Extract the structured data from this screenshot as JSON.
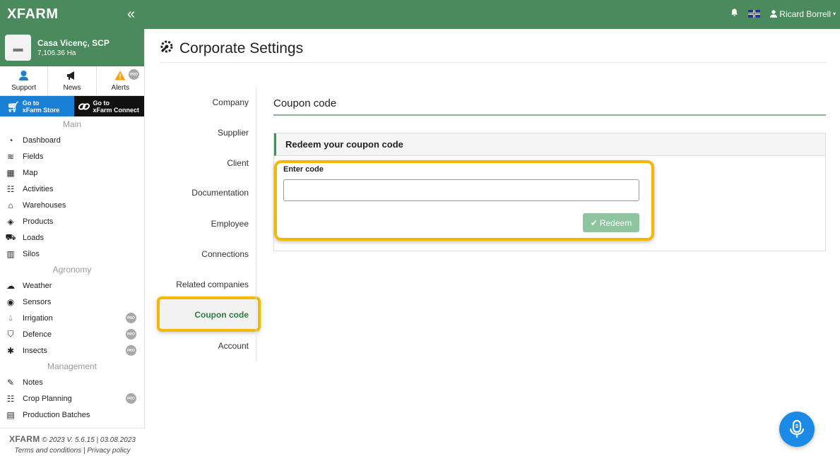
{
  "topbar": {
    "logo": "XFARM",
    "collapse_icon": "double-chevron-left-icon",
    "user_name": "Ricard Borrell"
  },
  "farm": {
    "name": "Casa Vicenç, SCP",
    "area": "7,106.36 Ha"
  },
  "quick_links": [
    {
      "label": "Support",
      "icon": "support-icon"
    },
    {
      "label": "News",
      "icon": "megaphone-icon"
    },
    {
      "label": "Alerts",
      "icon": "warning-icon",
      "badge": "PRO"
    }
  ],
  "store": {
    "store_line1": "Go to",
    "store_line2": "xFarm Store",
    "connect_line1": "Go to",
    "connect_line2": "xFarm Connect"
  },
  "sidebar": {
    "main_title": "Main",
    "main_items": [
      "Dashboard",
      "Fields",
      "Map",
      "Activities",
      "Warehouses",
      "Products",
      "Loads",
      "Silos"
    ],
    "agronomy_title": "Agronomy",
    "agronomy_items": [
      "Weather",
      "Sensors",
      "Irrigation",
      "Defence",
      "Insects"
    ],
    "management_title": "Management",
    "management_items": [
      "Notes",
      "Crop Planning",
      "Production Batches"
    ],
    "pro_badge": "PRO"
  },
  "footer": {
    "brand": "XFARM",
    "version": "© 2023 V. 5.6.15 | 03.08.2023",
    "links": "Terms and conditions | Privacy policy"
  },
  "page": {
    "title": "Corporate Settings"
  },
  "settings_nav": [
    "Company",
    "Supplier",
    "Client",
    "Documentation",
    "Employee",
    "Connections",
    "Related companies",
    "Coupon code",
    "Account"
  ],
  "coupon": {
    "section_title": "Coupon code",
    "panel_title": "Redeem your coupon code",
    "input_label": "Enter code",
    "input_value": "",
    "redeem_label": "Redeem"
  },
  "colors": {
    "brand_green": "#4a8a5c",
    "highlight": "#f5b800",
    "store_blue": "#1a7fd6",
    "redeem_disabled": "#8fc4a0",
    "mic_blue": "#1a8ae6"
  }
}
